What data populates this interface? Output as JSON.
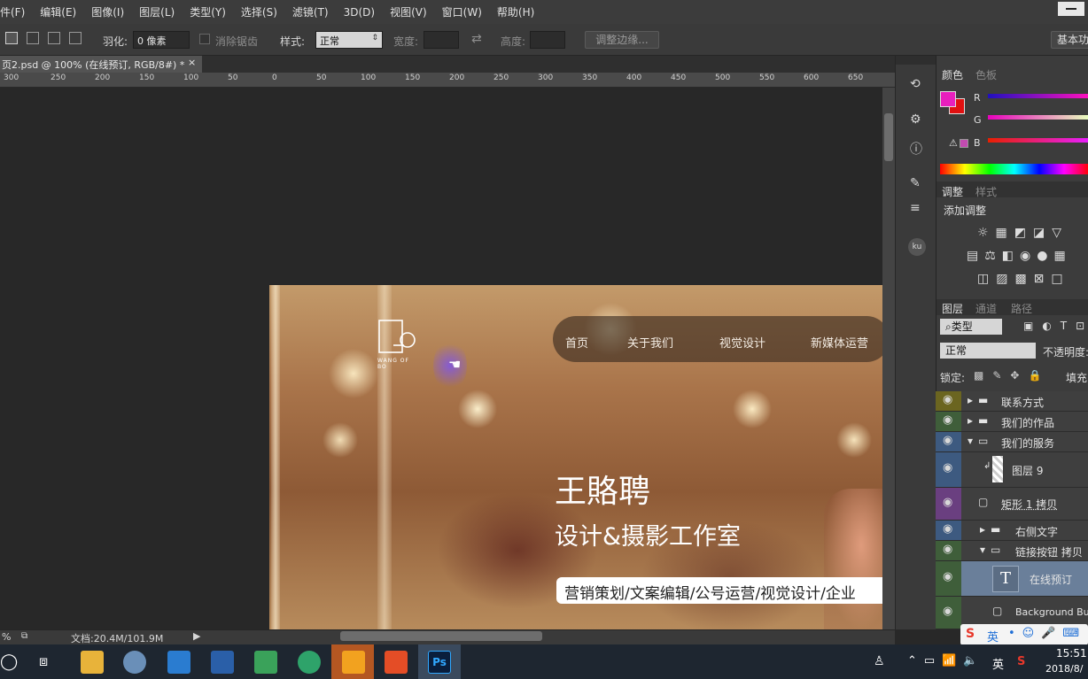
{
  "menu": [
    "件(F)",
    "编辑(E)",
    "图像(I)",
    "图层(L)",
    "类型(Y)",
    "选择(S)",
    "滤镜(T)",
    "3D(D)",
    "视图(V)",
    "窗口(W)",
    "帮助(H)"
  ],
  "options": {
    "feather_label": "羽化:",
    "feather_value": "0 像素",
    "antialias_label": "消除锯齿",
    "style_label": "样式:",
    "style_value": "正常",
    "width_label": "宽度:",
    "height_label": "高度:",
    "refine_edge_button": "调整边缘...",
    "workspace_button": "基本功"
  },
  "document": {
    "tab_title": "页2.psd @ 100% (在线预订, RGB/8#) *",
    "close_icon": "×",
    "ruler_ticks": [
      "300",
      "250",
      "200",
      "150",
      "100",
      "50",
      "0",
      "50",
      "100",
      "150",
      "200",
      "250",
      "300",
      "350",
      "400",
      "450",
      "500",
      "550",
      "600",
      "650"
    ]
  },
  "artwork": {
    "logo_text": "WANG OF BO",
    "nav": [
      "首页",
      "关于我们",
      "视觉设计",
      "新媒体运营"
    ],
    "heading": "王賂聘",
    "subheading": "设计&摄影工作室",
    "tagline": "营销策划/文案编辑/公号运营/视觉设计/企业"
  },
  "color_panel": {
    "tabs": [
      "颜色",
      "色板"
    ],
    "channels": [
      "R",
      "G",
      "B"
    ],
    "fg_color": "#e81fbd",
    "bg_color": "#e01010"
  },
  "adjust_panel": {
    "tabs": [
      "调整",
      "样式"
    ],
    "title": "添加调整"
  },
  "layers_panel": {
    "tabs": [
      "图层",
      "通道",
      "路径"
    ],
    "filter_label": "类型",
    "blend_mode": "正常",
    "opacity_label": "不透明度:",
    "lock_label": "锁定:",
    "fill_label": "填充:",
    "layers": [
      {
        "name": "联系方式",
        "type": "group",
        "color": "#6b6520"
      },
      {
        "name": "我们的作品",
        "type": "group",
        "color": "#3f5e3a"
      },
      {
        "name": "我们的服务",
        "type": "group",
        "color": "#3d5a80"
      },
      {
        "name": "图层 9",
        "type": "layer",
        "color": "#3d5a80"
      },
      {
        "name": "矩形 1 拷贝",
        "type": "shape",
        "color": "#6a3f80"
      },
      {
        "name": "右侧文字",
        "type": "group",
        "color": "#3d5a80"
      },
      {
        "name": "链接按钮 拷贝",
        "type": "group",
        "color": "#3f5e3a"
      },
      {
        "name": "在线预订",
        "type": "text",
        "color": "#3f5e3a"
      },
      {
        "name": "Background Butt",
        "type": "shape",
        "color": "#3f5e3a"
      }
    ]
  },
  "status": {
    "zoom": "%",
    "doc_info": "文档:20.4M/101.9M"
  },
  "taskbar": {
    "time": "15:51",
    "date": "2018/8/",
    "ime_label": "英"
  }
}
